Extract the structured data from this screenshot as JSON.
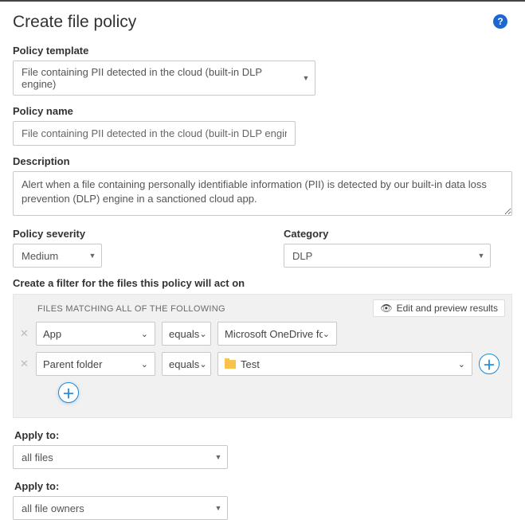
{
  "header": {
    "title": "Create file policy",
    "help_label": "?"
  },
  "fields": {
    "policy_template": {
      "label": "Policy template",
      "value": "File containing PII detected in the cloud (built-in DLP engine)"
    },
    "policy_name": {
      "label": "Policy name",
      "value": "File containing PII detected in the cloud (built-in DLP engine)"
    },
    "description": {
      "label": "Description",
      "value": "Alert when a file containing personally identifiable information (PII) is detected by our built-in data loss prevention (DLP) engine in a sanctioned cloud app."
    },
    "policy_severity": {
      "label": "Policy severity",
      "value": "Medium"
    },
    "category": {
      "label": "Category",
      "value": "DLP"
    }
  },
  "filter": {
    "heading": "Create a filter for the files this policy will act on",
    "subheading": "FILES MATCHING ALL OF THE FOLLOWING",
    "edit_preview_label": "Edit and preview results",
    "rows": [
      {
        "attr": "App",
        "op": "equals",
        "value": "Microsoft OneDrive fo..."
      },
      {
        "attr": "Parent folder",
        "op": "equals",
        "value": "Test",
        "has_folder_icon": true,
        "has_plus": true
      }
    ]
  },
  "apply": {
    "label1": "Apply to:",
    "value1": "all files",
    "label2": "Apply to:",
    "value2": "all file owners"
  }
}
